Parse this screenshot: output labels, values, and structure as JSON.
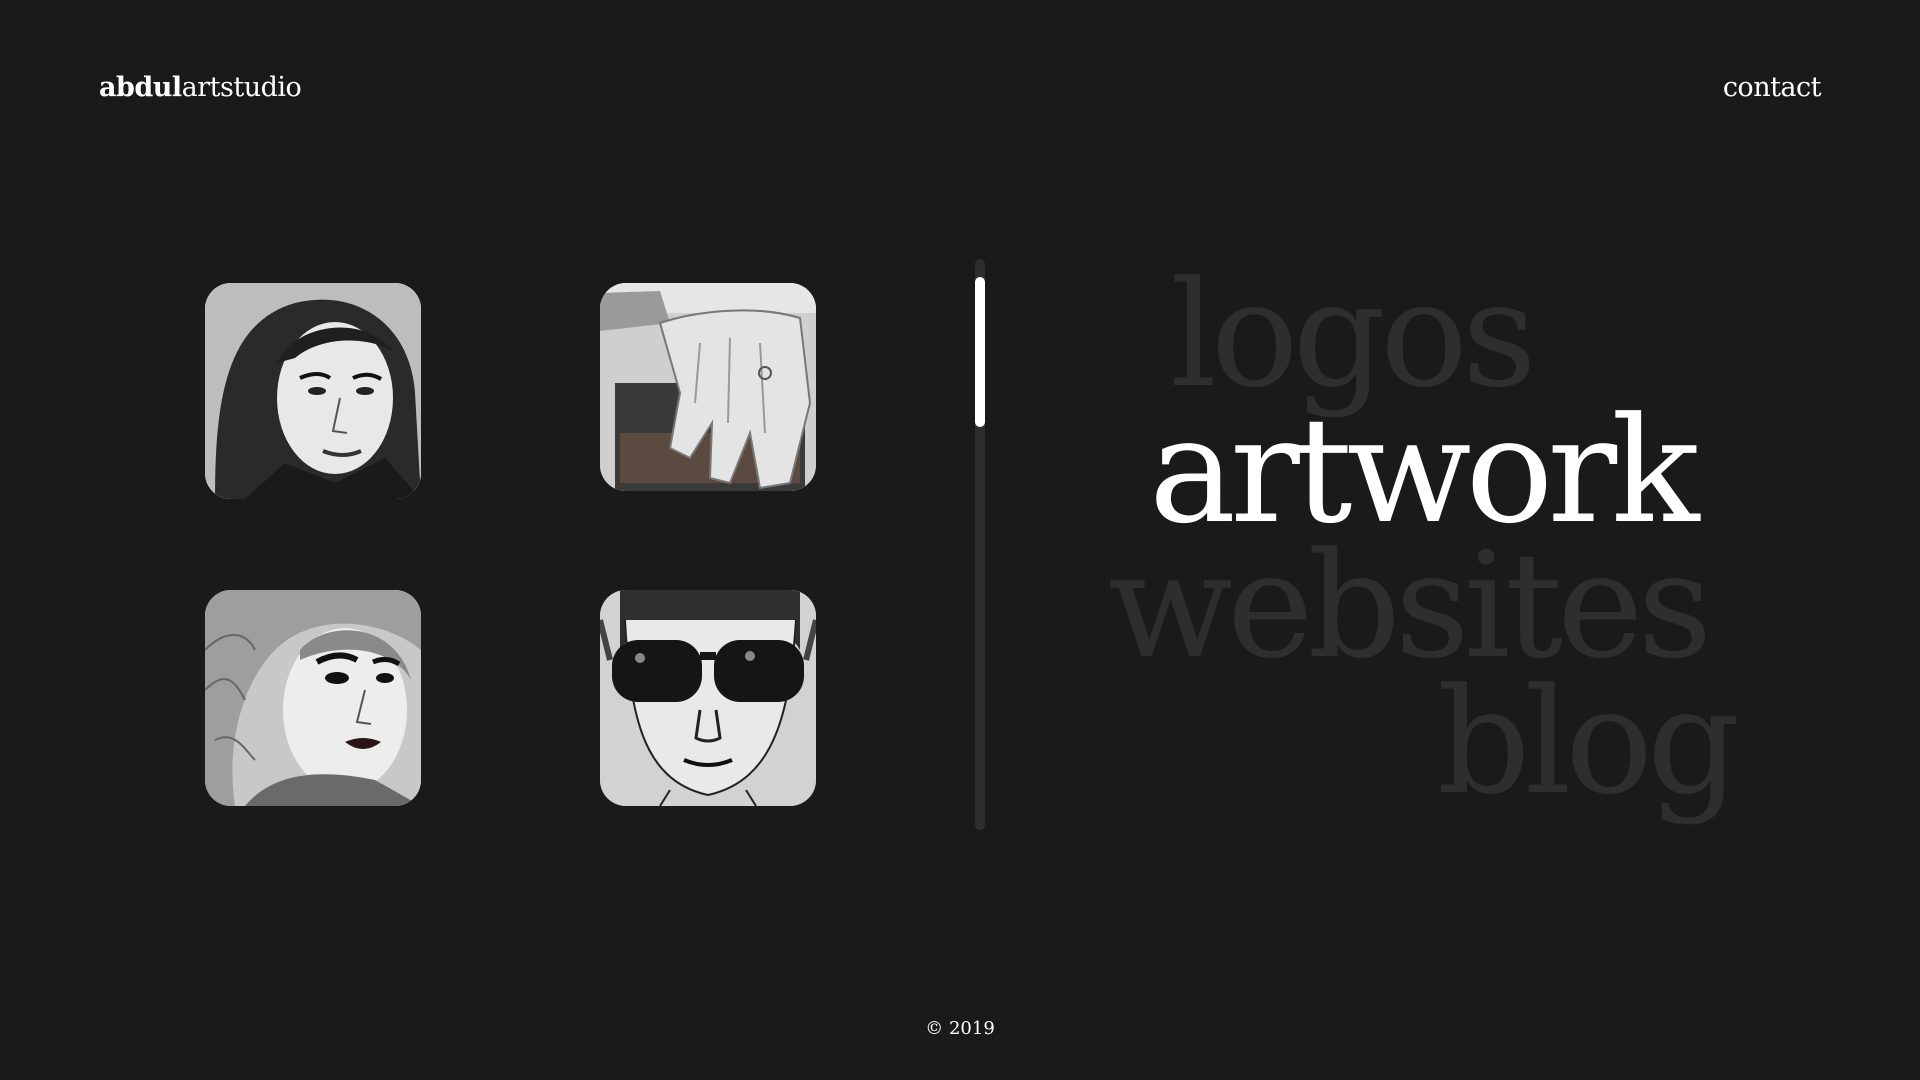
{
  "header": {
    "logo_bold": "abdul",
    "logo_rest": "artstudio",
    "contact_label": "contact"
  },
  "gallery": {
    "items": [
      {
        "icon": "portrait-woman-sketch"
      },
      {
        "icon": "hand-on-book-sketch"
      },
      {
        "icon": "portrait-woman-red-lips-sketch"
      },
      {
        "icon": "portrait-sunglasses-sketch"
      }
    ]
  },
  "scrollbar": {
    "position": 0.03,
    "visible_fraction": 0.26
  },
  "menu": {
    "items": [
      {
        "label": "logos",
        "active": false
      },
      {
        "label": "artwork",
        "active": true
      },
      {
        "label": "websites",
        "active": false
      },
      {
        "label": "blog",
        "active": false
      }
    ]
  },
  "footer": {
    "copyright": "© 2019"
  },
  "colors": {
    "background": "#1a1a1a",
    "text": "#ffffff",
    "inactive_menu": "#2e2e2e"
  }
}
